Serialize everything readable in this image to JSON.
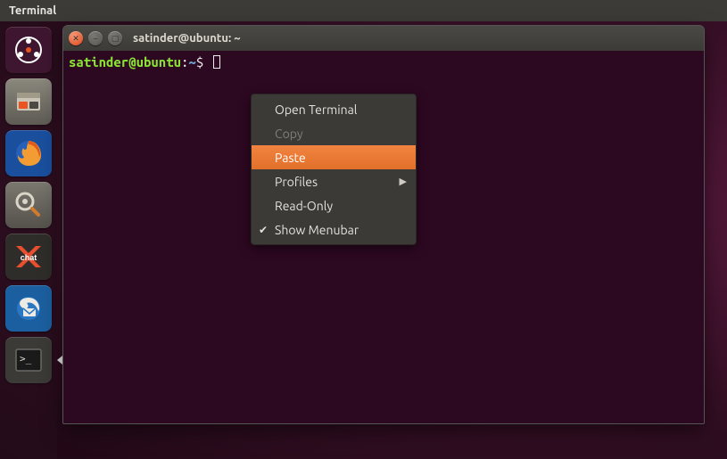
{
  "menubar": {
    "app": "Terminal"
  },
  "launcher": {
    "active_index": 6,
    "items": [
      {
        "name": "dash-icon",
        "bg": "#3f1630"
      },
      {
        "name": "files-icon",
        "bg": "#6c6a63"
      },
      {
        "name": "firefox-icon",
        "bg": "#1a4f9e"
      },
      {
        "name": "settings-icon",
        "bg": "#5f5d57"
      },
      {
        "name": "xchat-icon",
        "bg": "#2f2d29"
      },
      {
        "name": "thunderbird-icon",
        "bg": "#1b5fa0"
      },
      {
        "name": "terminal-icon",
        "bg": "#3b3a36"
      }
    ]
  },
  "window": {
    "title": "satinder@ubuntu: ~",
    "prompt": {
      "userhost": "satinder@ubuntu",
      "sep": ":",
      "path": "~",
      "symbol": "$"
    }
  },
  "context_menu": {
    "items": [
      {
        "label": "Open Terminal",
        "state": "normal"
      },
      {
        "label": "Copy",
        "state": "disabled"
      },
      {
        "label": "Paste",
        "state": "hover"
      },
      {
        "label": "Profiles",
        "state": "submenu"
      },
      {
        "label": "Read-Only",
        "state": "normal"
      },
      {
        "label": "Show Menubar",
        "state": "checked"
      }
    ]
  }
}
